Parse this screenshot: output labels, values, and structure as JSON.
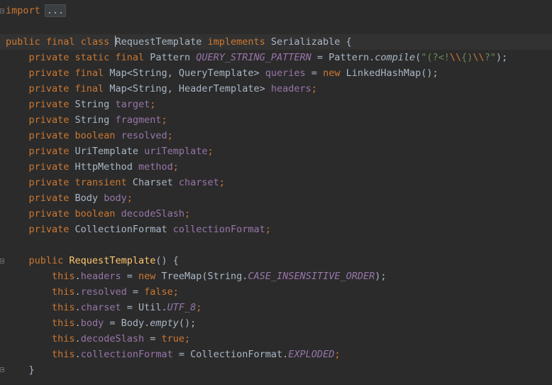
{
  "editor": {
    "collapsed_import": {
      "keyword": "import",
      "placeholder": "..."
    },
    "lines": [
      [
        [
          "kw",
          "import"
        ],
        [
          "collapsed",
          "..."
        ]
      ],
      [],
      [
        [
          "kw",
          "public final class "
        ],
        [
          "caret",
          ""
        ],
        [
          "cls",
          "RequestTemplate "
        ],
        [
          "kw",
          "implements "
        ],
        [
          "cls",
          "Serializable {"
        ]
      ],
      [
        [
          "plain",
          "    "
        ],
        [
          "kw",
          "private static final "
        ],
        [
          "cls",
          "Pattern "
        ],
        [
          "sfld",
          "QUERY_STRING_PATTERN"
        ],
        [
          "plain",
          " = Pattern."
        ],
        [
          "static-call",
          "compile"
        ],
        [
          "plain",
          "("
        ],
        [
          "str",
          "\"(?<!"
        ],
        [
          "esc",
          "\\\\"
        ],
        [
          "str",
          "{)"
        ],
        [
          "esc",
          "\\\\"
        ],
        [
          "str",
          "?\""
        ],
        [
          "plain",
          ");"
        ]
      ],
      [
        [
          "plain",
          "    "
        ],
        [
          "kw",
          "private final "
        ],
        [
          "cls",
          "Map<String, QueryTemplate> "
        ],
        [
          "fld",
          "queries"
        ],
        [
          "plain",
          " = "
        ],
        [
          "kw",
          "new "
        ],
        [
          "cls",
          "LinkedHashMap();"
        ]
      ],
      [
        [
          "plain",
          "    "
        ],
        [
          "kw",
          "private final "
        ],
        [
          "cls",
          "Map<String, HeaderTemplate> "
        ],
        [
          "fld",
          "headers"
        ],
        [
          "kw",
          ";"
        ]
      ],
      [
        [
          "plain",
          "    "
        ],
        [
          "kw",
          "private "
        ],
        [
          "cls",
          "String "
        ],
        [
          "fld",
          "target"
        ],
        [
          "kw",
          ";"
        ]
      ],
      [
        [
          "plain",
          "    "
        ],
        [
          "kw",
          "private "
        ],
        [
          "cls",
          "String "
        ],
        [
          "fld",
          "fragment"
        ],
        [
          "kw",
          ";"
        ]
      ],
      [
        [
          "plain",
          "    "
        ],
        [
          "kw",
          "private boolean "
        ],
        [
          "fld",
          "resolved"
        ],
        [
          "kw",
          ";"
        ]
      ],
      [
        [
          "plain",
          "    "
        ],
        [
          "kw",
          "private "
        ],
        [
          "cls",
          "UriTemplate "
        ],
        [
          "fld",
          "uriTemplate"
        ],
        [
          "kw",
          ";"
        ]
      ],
      [
        [
          "plain",
          "    "
        ],
        [
          "kw",
          "private "
        ],
        [
          "cls",
          "HttpMethod "
        ],
        [
          "fld",
          "method"
        ],
        [
          "kw",
          ";"
        ]
      ],
      [
        [
          "plain",
          "    "
        ],
        [
          "kw",
          "private transient "
        ],
        [
          "cls",
          "Charset "
        ],
        [
          "fld",
          "charset"
        ],
        [
          "kw",
          ";"
        ]
      ],
      [
        [
          "plain",
          "    "
        ],
        [
          "kw",
          "private "
        ],
        [
          "cls",
          "Body "
        ],
        [
          "fld",
          "body"
        ],
        [
          "kw",
          ";"
        ]
      ],
      [
        [
          "plain",
          "    "
        ],
        [
          "kw",
          "private boolean "
        ],
        [
          "fld",
          "decodeSlash"
        ],
        [
          "kw",
          ";"
        ]
      ],
      [
        [
          "plain",
          "    "
        ],
        [
          "kw",
          "private "
        ],
        [
          "cls",
          "CollectionFormat "
        ],
        [
          "fld",
          "collectionFormat"
        ],
        [
          "kw",
          ";"
        ]
      ],
      [],
      [
        [
          "plain",
          "    "
        ],
        [
          "kw",
          "public "
        ],
        [
          "method",
          "RequestTemplate"
        ],
        [
          "plain",
          "() {"
        ]
      ],
      [
        [
          "plain",
          "        "
        ],
        [
          "kw",
          "this"
        ],
        [
          "plain",
          "."
        ],
        [
          "fld",
          "headers"
        ],
        [
          "plain",
          " = "
        ],
        [
          "kw",
          "new "
        ],
        [
          "cls",
          "TreeMap(String."
        ],
        [
          "sfld",
          "CASE_INSENSITIVE_ORDER"
        ],
        [
          "plain",
          ");"
        ]
      ],
      [
        [
          "plain",
          "        "
        ],
        [
          "kw",
          "this"
        ],
        [
          "plain",
          "."
        ],
        [
          "fld",
          "resolved"
        ],
        [
          "plain",
          " = "
        ],
        [
          "kw",
          "false;"
        ]
      ],
      [
        [
          "plain",
          "        "
        ],
        [
          "kw",
          "this"
        ],
        [
          "plain",
          "."
        ],
        [
          "fld",
          "charset"
        ],
        [
          "plain",
          " = Util."
        ],
        [
          "sfld",
          "UTF_8"
        ],
        [
          "kw",
          ";"
        ]
      ],
      [
        [
          "plain",
          "        "
        ],
        [
          "kw",
          "this"
        ],
        [
          "plain",
          "."
        ],
        [
          "fld",
          "body"
        ],
        [
          "plain",
          " = Body."
        ],
        [
          "static-call",
          "empty"
        ],
        [
          "plain",
          "();"
        ]
      ],
      [
        [
          "plain",
          "        "
        ],
        [
          "kw",
          "this"
        ],
        [
          "plain",
          "."
        ],
        [
          "fld",
          "decodeSlash"
        ],
        [
          "plain",
          " = "
        ],
        [
          "kw",
          "true;"
        ]
      ],
      [
        [
          "plain",
          "        "
        ],
        [
          "kw",
          "this"
        ],
        [
          "plain",
          "."
        ],
        [
          "fld",
          "collectionFormat"
        ],
        [
          "plain",
          " = CollectionFormat."
        ],
        [
          "sfld",
          "EXPLODED"
        ],
        [
          "kw",
          ";"
        ]
      ],
      [
        [
          "plain",
          "    }"
        ]
      ]
    ],
    "current_line": 2
  }
}
